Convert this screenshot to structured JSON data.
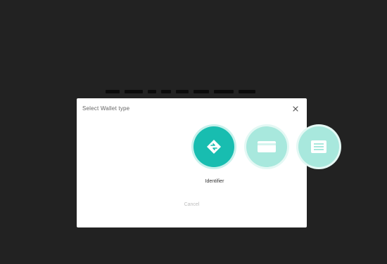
{
  "dialog": {
    "title": "Select Wallet type",
    "close_icon": "close-icon",
    "options": [
      {
        "label": "Identifier",
        "icon": "diamond-arrows-icon",
        "state": "active"
      },
      {
        "label": "",
        "icon": "card-icon",
        "state": "inactive"
      },
      {
        "label": "",
        "icon": "list-icon",
        "state": "inactive"
      }
    ],
    "cancel_label": "Cancel"
  },
  "colors": {
    "backdrop": "#222222",
    "accent": "#18bdb0",
    "accent_light": "#a8e8dd"
  }
}
